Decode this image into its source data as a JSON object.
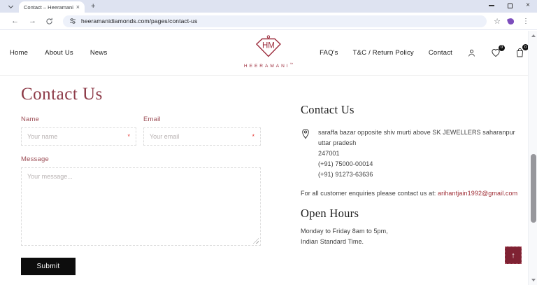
{
  "browser": {
    "tab_title": "Contact – Heeramani",
    "url": "heeramanidiamonds.com/pages/contact-us"
  },
  "icons": {
    "tab_close": "×",
    "new_tab": "+",
    "window_close": "×",
    "back": "←",
    "forward": "→",
    "star": "☆",
    "menu": "⋮",
    "back_to_top": "↑",
    "required": "*"
  },
  "header": {
    "nav_left": [
      {
        "label": "Home"
      },
      {
        "label": "About Us"
      },
      {
        "label": "News"
      }
    ],
    "logo": {
      "monogram": "HM",
      "brand": "HEERAMANI",
      "tm": "™"
    },
    "nav_right": [
      {
        "label": "FAQ's"
      },
      {
        "label": "T&C / Return Policy"
      },
      {
        "label": "Contact"
      }
    ],
    "wishlist_count": "0",
    "cart_count": "0"
  },
  "main": {
    "page_title": "Contact Us",
    "form": {
      "name_label": "Name",
      "name_placeholder": "Your name",
      "email_label": "Email",
      "email_placeholder": "Your email",
      "message_label": "Message",
      "message_placeholder": "Your message...",
      "submit_label": "Submit"
    },
    "info": {
      "heading": "Contact Us",
      "address_line1": "saraffa bazar opposite shiv murti above SK JEWELLERS saharanpur uttar pradesh",
      "address_line2": "247001",
      "phone1": "(+91) 75000-00014",
      "phone2": "(+91) 91273-63636",
      "enquiries_text": "For all customer enquiries please contact us at: ",
      "enquiries_email": "arihantjain1992@gmail.com",
      "open_hours_heading": "Open Hours",
      "open_hours_line1": "Monday to Friday 8am to 5pm,",
      "open_hours_line2": "Indian Standard Time."
    }
  },
  "colors": {
    "maroon_title": "#8d3a47",
    "logo_maroon": "#9c2c3c",
    "accent_dark": "#7f2233",
    "link_red": "#9e2b33",
    "badge_black": "#111111"
  }
}
